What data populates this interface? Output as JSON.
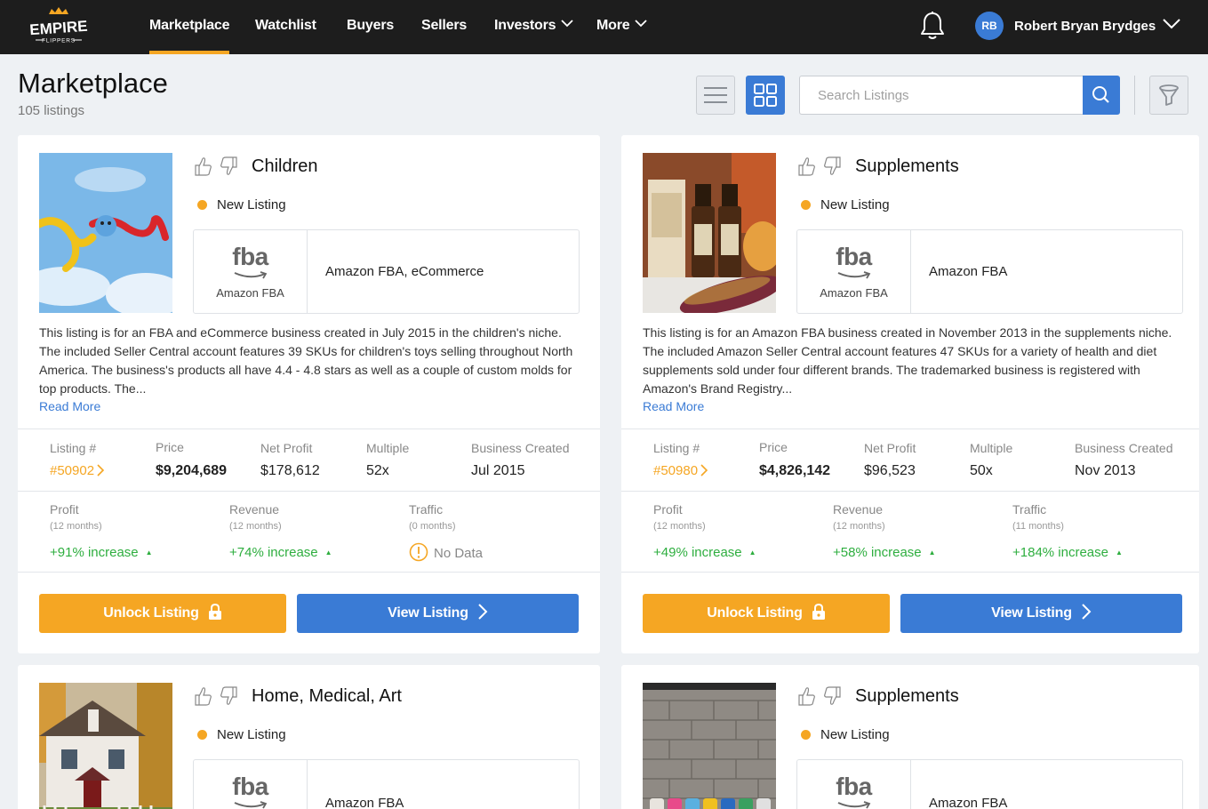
{
  "nav": {
    "logo_text": "EMPIRE",
    "logo_sub": "FLIPPERS",
    "items": [
      {
        "label": "Marketplace",
        "active": true
      },
      {
        "label": "Watchlist"
      },
      {
        "label": "Buyers"
      },
      {
        "label": "Sellers"
      },
      {
        "label": "Investors"
      },
      {
        "label": "More"
      }
    ],
    "user_initials": "RB",
    "user_name": "Robert Bryan Brydges",
    "accent": "#f5a623",
    "brand_blue": "#3a7bd5"
  },
  "header": {
    "title": "Marketplace",
    "count": "105 listings",
    "search_placeholder": "Search Listings"
  },
  "labels": {
    "listing": "Listing #",
    "price": "Price",
    "net_profit": "Net Profit",
    "multiple": "Multiple",
    "business_created": "Business Created",
    "profit": "Profit",
    "revenue": "Revenue",
    "traffic": "Traffic",
    "read_more": "Read More",
    "unlock": "Unlock Listing",
    "view": "View Listing",
    "no_data": "No Data",
    "fba": "fba",
    "fba_caption": "Amazon FBA"
  },
  "listings": [
    {
      "niche": "Children",
      "status": "New Listing",
      "monetization": "Amazon FBA, eCommerce",
      "description": "This listing is for an FBA and eCommerce business created in July 2015 in the children's niche. The included Seller Central account features 39 SKUs for children's toys selling throughout North America. The business's products all have 4.4 - 4.8 stars as well as a couple of custom molds for top products. The...",
      "listing_number": "#50902",
      "price": "$9,204,689",
      "net_profit": "$178,612",
      "multiple": "52x",
      "created": "Jul 2015",
      "profit_period": "(12 months)",
      "profit_trend": "+91% increase",
      "revenue_period": "(12 months)",
      "revenue_trend": "+74% increase",
      "traffic_period": "(0 months)",
      "traffic_trend": ""
    },
    {
      "niche": "Supplements",
      "status": "New Listing",
      "monetization": "Amazon FBA",
      "description": "This listing is for an Amazon FBA business created in November 2013 in the supplements niche. The included Amazon Seller Central account features 47 SKUs for a variety of health and diet supplements sold under four different brands. The trademarked business is registered with Amazon's Brand Registry...",
      "listing_number": "#50980",
      "price": "$4,826,142",
      "net_profit": "$96,523",
      "multiple": "50x",
      "created": "Nov 2013",
      "profit_period": "(12 months)",
      "profit_trend": "+49% increase",
      "revenue_period": "(12 months)",
      "revenue_trend": "+58% increase",
      "traffic_period": "(11 months)",
      "traffic_trend": "+184% increase"
    },
    {
      "niche": "Home, Medical, Art",
      "status": "New Listing",
      "monetization": "Amazon FBA"
    },
    {
      "niche": "Supplements",
      "status": "New Listing",
      "monetization": "Amazon FBA"
    }
  ]
}
